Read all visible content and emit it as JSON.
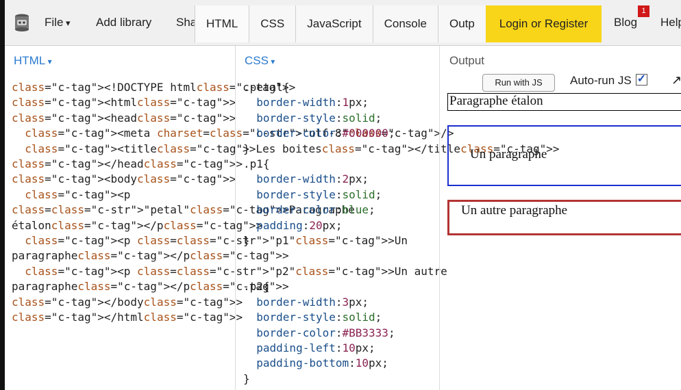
{
  "toolbar": {
    "file_label": "File",
    "add_library_label": "Add library",
    "share_label": "Share",
    "tabs": [
      "HTML",
      "CSS",
      "JavaScript",
      "Console",
      "Outp"
    ],
    "login_label": "Login or Register",
    "blog_label": "Blog",
    "blog_badge": "1",
    "help_label": "Help"
  },
  "panels": {
    "html_title": "HTML",
    "css_title": "CSS",
    "output_title": "Output"
  },
  "output": {
    "run_button": "Run with JS",
    "autorun_label": "Auto-run JS",
    "autorun_checked": true,
    "expand_icon": "expand-arrow-icon",
    "p_petal": "Paragraphe étalon",
    "p_p1": "Un paragraphe",
    "p_p2": "Un autre paragraphe"
  },
  "html_code": [
    "<!DOCTYPE html>",
    "<html>",
    "<head>",
    "  <meta charset=\"utf-8\"/>",
    "  <title>Les boites</title>",
    "</head>",
    "<body>",
    "  <p",
    "class=\"petal\">Paragraphe",
    "étalon</p>",
    "  <p class=\"p1\">Un",
    "paragraphe</p>",
    "  <p class=\"p2\">Un autre",
    "paragraphe</p>",
    "</body>",
    "</html>"
  ],
  "css_code": [
    ".petal{",
    "  border-width:1px;",
    "  border-style:solid;",
    "  border-color:#000000;",
    "}",
    ".p1{",
    "  border-width:2px;",
    "  border-style:solid;",
    "  border-color:blue;",
    "  padding:20px;",
    "}",
    "",
    "",
    ".p2{",
    "  border-width:3px;",
    "  border-style:solid;",
    "  border-color:#BB3333;",
    "  padding-left:10px;",
    "  padding-bottom:10px;",
    "}"
  ],
  "colors": {
    "login_bg": "#f8d518",
    "p1_border": "#1a2fcf",
    "p2_border": "#b33333",
    "panel_title": "#2a7ad0"
  }
}
